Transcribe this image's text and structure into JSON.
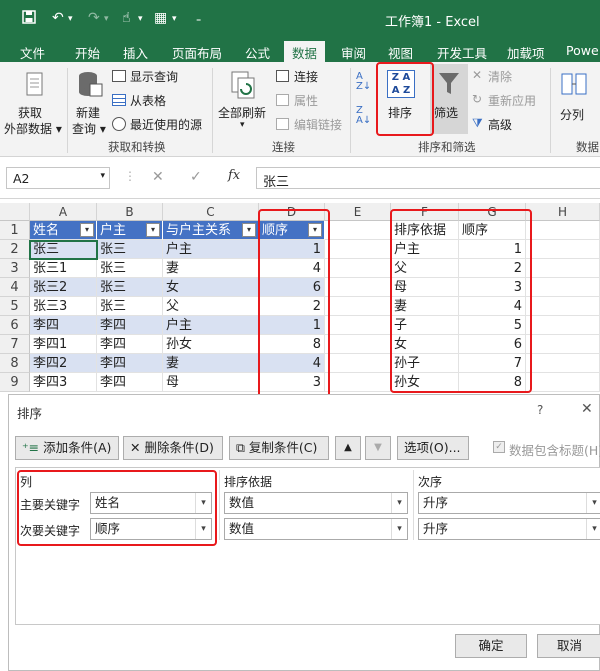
{
  "title_bar": {
    "title": "工作簿1 - Excel",
    "save_icon": "save-icon",
    "undo_icon": "undo-icon",
    "redo_icon": "redo-icon"
  },
  "tabs": [
    "文件",
    "开始",
    "插入",
    "页面布局",
    "公式",
    "数据",
    "审阅",
    "视图",
    "开发工具",
    "加载项",
    "Powe"
  ],
  "active_tab": "数据",
  "ribbon": {
    "get_data": "获取\n外部数据",
    "new_query": "新建\n查询",
    "show_query": "显示查询",
    "from_table": "从表格",
    "recent_sources": "最近使用的源",
    "group_get_transform": "获取和转换",
    "refresh_all": "全部刷新",
    "connections": "连接",
    "properties": "属性",
    "edit_links": "编辑链接",
    "group_connections": "连接",
    "sort": "排序",
    "filter": "筛选",
    "clear": "清除",
    "reapply": "重新应用",
    "advanced": "高级",
    "group_sort_filter": "排序和筛选",
    "split": "分列",
    "group_data_partial": "数据",
    "sort_icon_text": "Z A\nA Z"
  },
  "formula_bar": {
    "name_box": "A2",
    "cancel": "✕",
    "enter": "✓",
    "fx": "fx",
    "content": "张三"
  },
  "columns": [
    "A",
    "B",
    "C",
    "D",
    "E",
    "F",
    "G",
    "H"
  ],
  "rows": [
    "1",
    "2",
    "3",
    "4",
    "5",
    "6",
    "7",
    "8",
    "9"
  ],
  "table_headers": [
    "姓名",
    "户主",
    "与户主关系",
    "顺序"
  ],
  "table_rows": [
    [
      "张三",
      "张三",
      "户主",
      "1"
    ],
    [
      "张三1",
      "张三",
      "妻",
      "4"
    ],
    [
      "张三2",
      "张三",
      "女",
      "6"
    ],
    [
      "张三3",
      "张三",
      "父",
      "2"
    ],
    [
      "李四",
      "李四",
      "户主",
      "1"
    ],
    [
      "李四1",
      "李四",
      "孙女",
      "8"
    ],
    [
      "李四2",
      "李四",
      "妻",
      "4"
    ],
    [
      "李四3",
      "李四",
      "母",
      "3"
    ]
  ],
  "ref_headers": [
    "排序依据",
    "顺序"
  ],
  "ref_rows": [
    [
      "户主",
      "1"
    ],
    [
      "父",
      "2"
    ],
    [
      "母",
      "3"
    ],
    [
      "妻",
      "4"
    ],
    [
      "子",
      "5"
    ],
    [
      "女",
      "6"
    ],
    [
      "孙子",
      "7"
    ],
    [
      "孙女",
      "8"
    ]
  ],
  "dialog": {
    "title": "排序",
    "help": "?",
    "add_level": "添加条件(A)",
    "delete_level": "删除条件(D)",
    "copy_level": "复制条件(C)",
    "options": "选项(O)...",
    "has_headers": "数据包含标题(H)",
    "col_header": "列",
    "sort_on_header": "排序依据",
    "order_header": "次序",
    "levels": [
      {
        "label": "主要关键字",
        "column": "姓名",
        "sort_on": "数值",
        "order": "升序"
      },
      {
        "label": "次要关键字",
        "column": "顺序",
        "sort_on": "数值",
        "order": "升序"
      }
    ],
    "ok": "确定",
    "cancel": "取消"
  },
  "colors": {
    "excel_green": "#217346",
    "table_header": "#4472c4",
    "band": "#d9e1f2",
    "highlight": "#e8191c"
  }
}
